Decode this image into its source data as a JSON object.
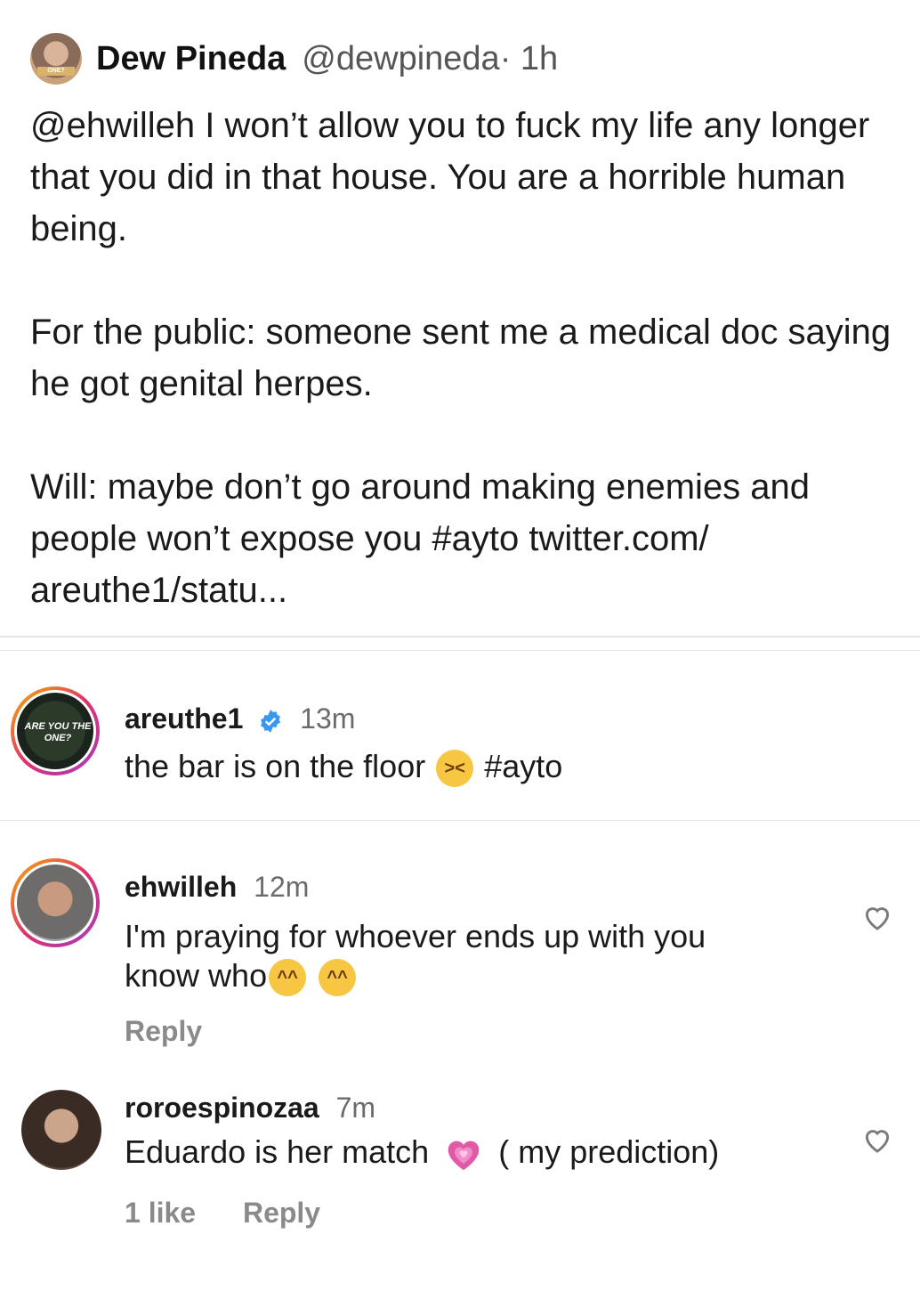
{
  "tweet": {
    "name": "Dew Pineda",
    "handle": "@dewpineda",
    "time": " · 1h",
    "avatar_badge": "ONE?",
    "body": "@ehwilleh I won’t allow you to fuck my life any longer that you did in that house. You are a horrible human being.\n\nFor the public: someone sent me a medical doc saying he got genital herpes.\n\nWill: maybe don’t go around making enemies and people won’t expose you #ayto twitter.com/\nareuthe1/statu..."
  },
  "comments": [
    {
      "username": "areuthe1",
      "verified": true,
      "time": "13m",
      "text": "the bar is on the floor",
      "emoji": "tired-face",
      "hashtag": "#ayto",
      "avatar_text": "ARE YOU THE ONE?"
    },
    {
      "username": "ehwilleh",
      "time": "12m",
      "text_line1": "I'm praying for whoever ends up with you",
      "text_line2": "know who",
      "emoji": "tears-of-joy",
      "reply": "Reply"
    },
    {
      "username": "roroespinozaa",
      "time": "7m",
      "text_before": "Eduardo is her match",
      "text_after": "( my prediction)",
      "emoji": "growing-heart",
      "likes": "1 like",
      "reply": "Reply"
    }
  ],
  "colors": {
    "text": "#1a1a1a",
    "muted": "#6b6b6b",
    "verified": "#3897f0",
    "story_ring": "#e1306c"
  }
}
